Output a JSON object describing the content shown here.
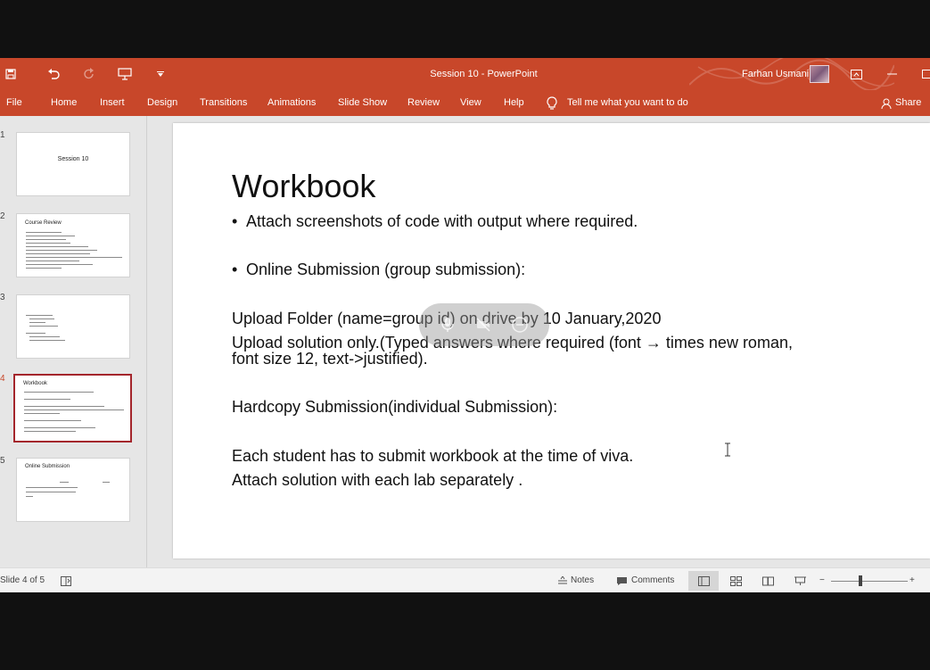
{
  "window": {
    "title": "Session 10  -  PowerPoint",
    "user_name": "Farhan Usmani",
    "share_label": "Share",
    "tell_me": "Tell me what you want to do"
  },
  "ribbon_tabs": [
    "File",
    "Home",
    "Insert",
    "Design",
    "Transitions",
    "Animations",
    "Slide Show",
    "Review",
    "View",
    "Help"
  ],
  "thumbnails": [
    {
      "number": "1",
      "title": "Session 10"
    },
    {
      "number": "2",
      "title": "Course Review"
    },
    {
      "number": "3",
      "title": ""
    },
    {
      "number": "4",
      "title": "Workbook"
    },
    {
      "number": "5",
      "title": "Online Submission"
    }
  ],
  "slide": {
    "title": "Workbook",
    "bullet_1": "Attach screenshots of code with output where required.",
    "bullet_2": "Online Submission (group submission):",
    "line_1": "Upload Folder (name=group id) on drive by 10 January,2020",
    "line_2": "Upload solution only.(Typed  answers where required (font → times new roman,",
    "line_3": "font size 12, text->justified).",
    "line_4": "Hardcopy Submission(individual Submission):",
    "line_5": "Each student has to submit workbook at the time of viva.",
    "line_6": "Attach solution with each lab separately ."
  },
  "status": {
    "slide_indicator": "Slide 4 of 5",
    "notes_label": "Notes",
    "comments_label": "Comments"
  },
  "colors": {
    "accent": "#c8472a",
    "active_slide_border": "#a4262c"
  },
  "icons": [
    "save-icon",
    "undo-icon",
    "redo-icon",
    "present-from-start-icon",
    "customize-qat-icon",
    "ribbon-display-icon",
    "minimize-icon",
    "restore-icon",
    "lightbulb-icon",
    "person-icon",
    "notes-icon",
    "comments-icon",
    "normal-view-icon",
    "slide-sorter-icon",
    "reading-view-icon",
    "slideshow-icon",
    "accessibility-icon",
    "zoom-out-icon",
    "zoom-in-icon",
    "text-cursor-icon"
  ]
}
